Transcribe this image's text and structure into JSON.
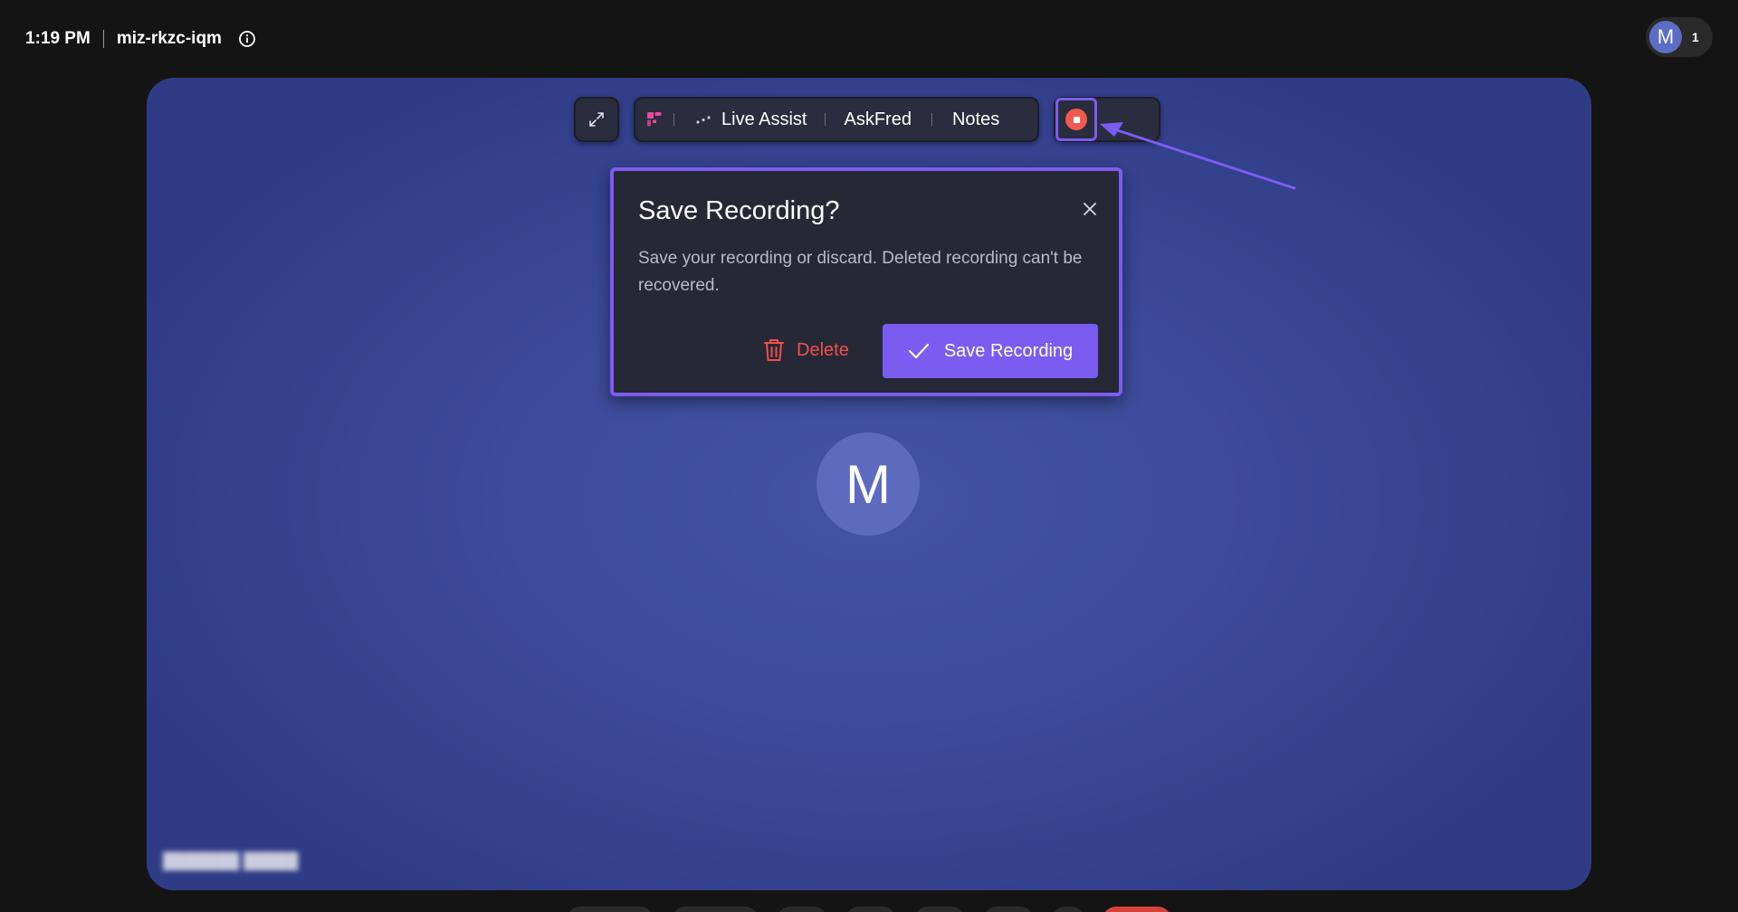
{
  "topbar": {
    "time": "1:19 PM",
    "meeting_code": "miz-rkzc-iqm",
    "participants_avatar": "M",
    "participants_count": "1"
  },
  "toolbar": {
    "items": [
      "Live Assist",
      "AskFred",
      "Notes"
    ],
    "icons": [
      "expand-icon",
      "fireflies-logo-icon",
      "live-assist-dots-icon",
      "record-stop-icon"
    ]
  },
  "dialog": {
    "title": "Save Recording?",
    "message": "Save your recording or discard. Deleted recording can't be recovered.",
    "delete_label": "Delete",
    "save_label": "Save Recording"
  },
  "stage": {
    "avatar_initial": "M"
  },
  "colors": {
    "accent": "#7b5cf0",
    "record": "#f05a50",
    "delete": "#f0504a",
    "stage": "#3c4b9a",
    "background": "#141414"
  }
}
